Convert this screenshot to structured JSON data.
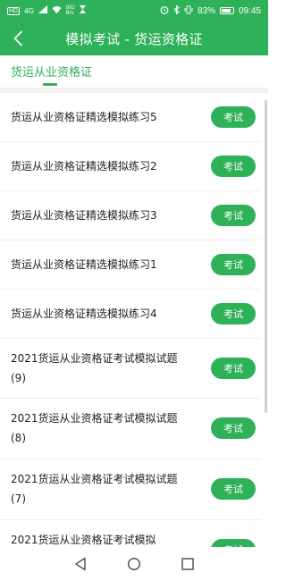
{
  "status_bar": {
    "carrier": "HD",
    "signal": "4G",
    "speed_value": "892",
    "speed_unit": "B/s",
    "battery": "83%",
    "time": "09:45"
  },
  "header": {
    "title": "模拟考试 - 货运资格证"
  },
  "tab": {
    "label": "货运从业资格证"
  },
  "items": [
    {
      "title": "货运从业资格证精选模拟练习5",
      "button": "考试"
    },
    {
      "title": "货运从业资格证精选模拟练习2",
      "button": "考试"
    },
    {
      "title": "货运从业资格证精选模拟练习3",
      "button": "考试"
    },
    {
      "title": "货运从业资格证精选模拟练习1",
      "button": "考试"
    },
    {
      "title": "货运从业资格证精选模拟练习4",
      "button": "考试"
    },
    {
      "title": "2021货运从业资格证考试模拟试题(9)",
      "button": "考试"
    },
    {
      "title": "2021货运从业资格证考试模拟试题(8)",
      "button": "考试"
    },
    {
      "title": "2021货运从业资格证考试模拟试题(7)",
      "button": "考试"
    },
    {
      "title": "2021货运从业资格证考试模拟",
      "button": "考试"
    }
  ],
  "colors": {
    "accent": "#2eb158"
  }
}
